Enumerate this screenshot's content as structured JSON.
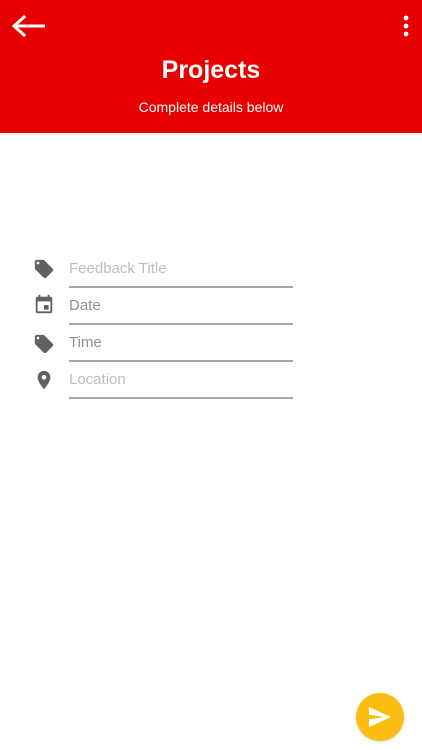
{
  "header": {
    "title": "Projects",
    "subtitle": "Complete details below",
    "background_color": "#e60000"
  },
  "form": {
    "fields": [
      {
        "name": "feedback-title",
        "placeholder": "Feedback Title",
        "icon": "tag-icon"
      },
      {
        "name": "date",
        "placeholder": "Date",
        "icon": "calendar-icon"
      },
      {
        "name": "time",
        "placeholder": "Time",
        "icon": "tag-icon"
      },
      {
        "name": "location",
        "placeholder": "Location",
        "icon": "location-pin-icon"
      }
    ]
  },
  "fab": {
    "icon": "send-icon",
    "color": "#fbbd12"
  }
}
